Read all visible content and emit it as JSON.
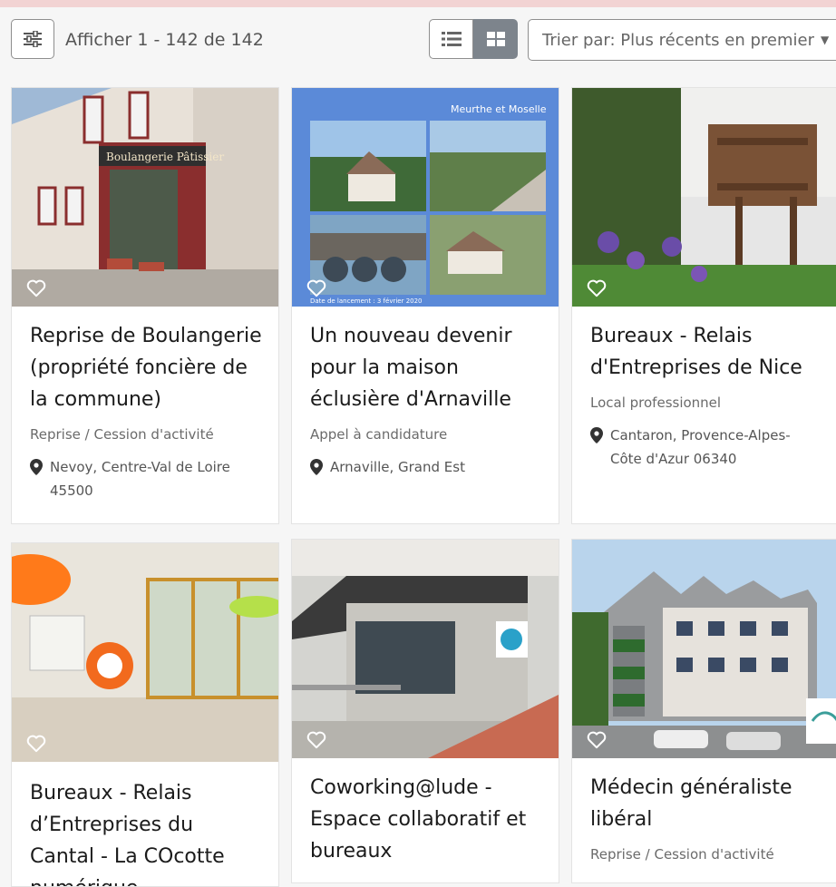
{
  "toolbar": {
    "count_text": "Afficher 1 - 142 de 142",
    "sort_label": "Trier par: Plus récents en premier",
    "active_view": "grid"
  },
  "cards": [
    {
      "title": "Reprise de Boulangerie (propriété foncière de la commune)",
      "type": "Reprise / Cession d'activité",
      "location": "Nevoy, Centre-Val de Loire 45500",
      "image_text": "Boulangerie Pâtissier"
    },
    {
      "title": "Un nouveau devenir pour la maison éclusière d'Arnaville",
      "type": "Appel à candidature",
      "location": "Arnaville, Grand Est",
      "image_text": "Meurthe et Moselle",
      "image_caption": "Date de lancement : 3 février 2020"
    },
    {
      "title": "Bureaux - Relais d'Entreprises de Nice",
      "type": "Local professionnel",
      "location": "Cantaron, Provence-Alpes-Côte d'Azur 06340"
    },
    {
      "title": "Bureaux - Relais d’Entreprises du Cantal - La COcotte numérique"
    },
    {
      "title": "Coworking@lude - Espace collaboratif et bureaux"
    },
    {
      "title": "Médecin généraliste libéral",
      "type": "Reprise / Cession d'activité"
    }
  ],
  "colors": {
    "top_band": "#f2d3d3",
    "active_view_bg": "#7d848c",
    "text_primary": "#1b1b1b",
    "text_muted": "#6b6b6b"
  }
}
